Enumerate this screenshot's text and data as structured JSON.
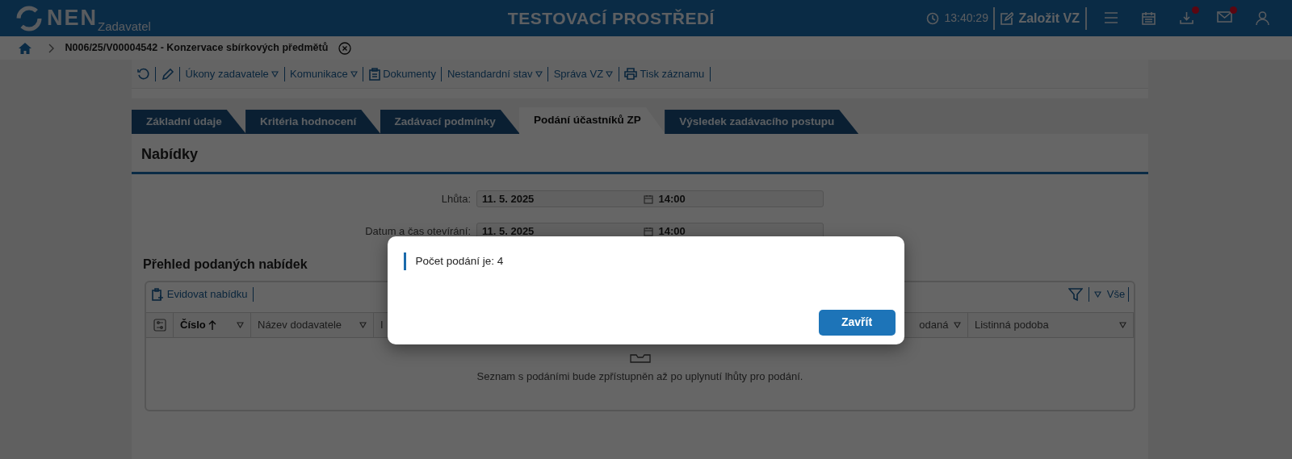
{
  "header": {
    "logo": "NEN",
    "subtitle": "Zadavatel",
    "environment": "TESTOVACÍ PROSTŘEDÍ",
    "clock": "13:40:29",
    "create_button": "Založit VZ",
    "icons": [
      {
        "kind": "menu",
        "notification": false
      },
      {
        "kind": "calendar",
        "notification": false
      },
      {
        "kind": "download",
        "notification": true
      },
      {
        "kind": "mail",
        "notification": true
      },
      {
        "kind": "user",
        "notification": false
      }
    ]
  },
  "breadcrumb": {
    "title": "N006/25/V00004542 - Konzervace sbírkových předmětů"
  },
  "toolbar": [
    {
      "kind": "refresh"
    },
    {
      "kind": "edit"
    },
    {
      "kind": "text",
      "label": "Úkony zadavatele",
      "dropdown": true
    },
    {
      "kind": "text",
      "label": "Komunikace",
      "dropdown": true
    },
    {
      "kind": "documents",
      "label": "Dokumenty",
      "dropdown": false
    },
    {
      "kind": "text",
      "label": "Nestandardní stav",
      "dropdown": true
    },
    {
      "kind": "text",
      "label": "Správa VZ",
      "dropdown": true
    },
    {
      "kind": "print",
      "label": "Tisk záznamu",
      "dropdown": false
    }
  ],
  "tabs": [
    {
      "label": "Základní údaje",
      "selected": false
    },
    {
      "label": "Kritéria hodnocení",
      "selected": false
    },
    {
      "label": "Zadávací podmínky",
      "selected": false
    },
    {
      "label": "Podání účastníků ZP",
      "selected": true
    },
    {
      "label": "Výsledek zadávacího postupu",
      "selected": false
    }
  ],
  "section_title": "Nabídky",
  "fields": [
    {
      "label": "Lhůta:",
      "date": "11. 5. 2025",
      "time": "14:00"
    },
    {
      "label": "Datum a čas otevírání:",
      "date": "11. 5. 2025",
      "time": "14:00"
    }
  ],
  "table": {
    "title": "Přehled podaných nabídek",
    "action": "Evidovat nabídku",
    "filter_label": "Vše",
    "columns": [
      {
        "label": "Číslo",
        "sorted": true
      },
      {
        "label": "Název dodavatele",
        "sorted": false
      },
      {
        "label": "I",
        "sorted": false
      },
      {
        "label": "odaná",
        "sorted": false
      },
      {
        "label": "Listinná podoba",
        "sorted": false
      }
    ],
    "empty_message": "Seznam s podáními bude zpřístupněn až po uplynutí lhůty pro podání."
  },
  "dialog": {
    "message": "Počet podání je: 4",
    "button": "Zavřít"
  }
}
